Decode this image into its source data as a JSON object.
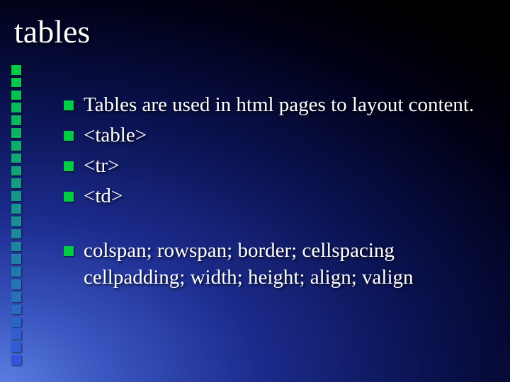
{
  "slide": {
    "title": "tables",
    "bullets_group1": [
      "Tables are used in html pages to layout content.",
      "<table>",
      "<tr>",
      "<td>"
    ],
    "bullets_group2": [
      "colspan; rowspan; border; cellspacing cellpadding; width; height; align; valign"
    ]
  },
  "colors": {
    "bullet": "#00cc44",
    "deco_top": "#00cc44",
    "deco_bottom": "#3355dd"
  }
}
